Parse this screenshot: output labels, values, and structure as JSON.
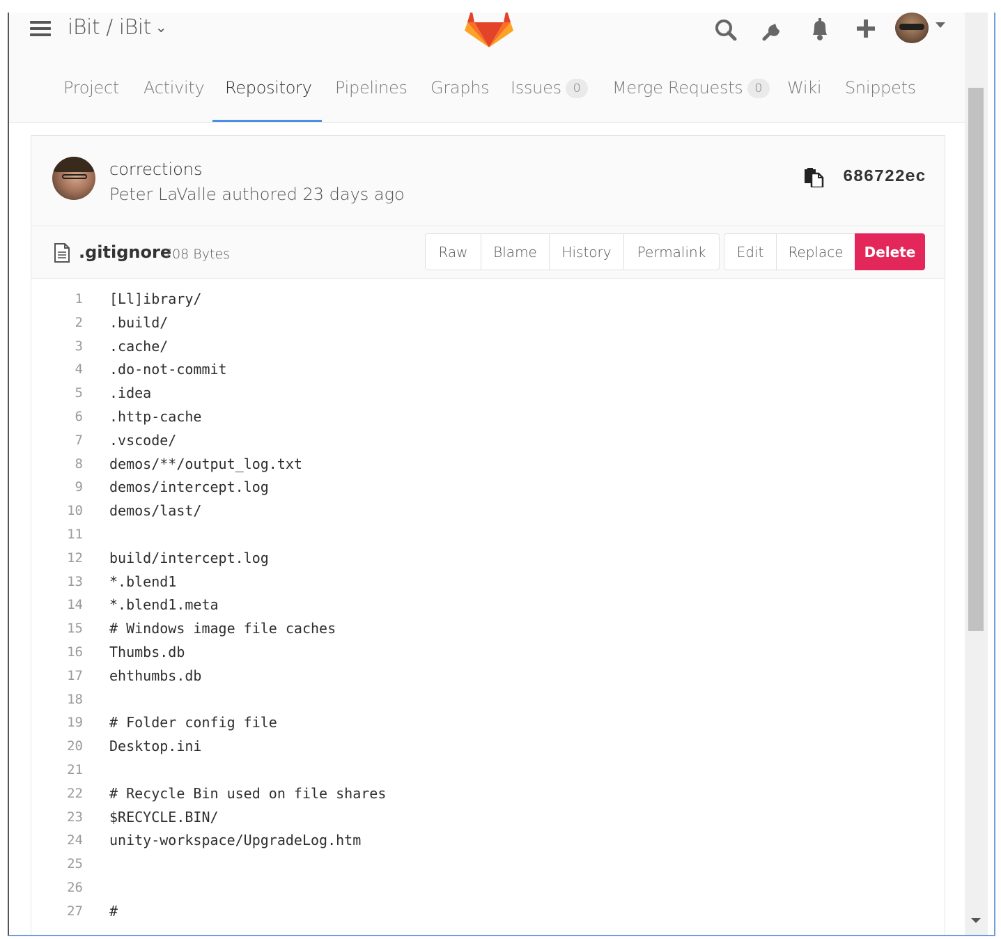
{
  "header": {
    "project_path": "iBit / iBit",
    "icons": [
      "search-icon",
      "wrench-icon",
      "bell-icon",
      "plus-icon",
      "user-avatar"
    ]
  },
  "nav": {
    "tabs": [
      {
        "label": "Project"
      },
      {
        "label": "Activity"
      },
      {
        "label": "Repository"
      },
      {
        "label": "Pipelines"
      },
      {
        "label": "Graphs"
      },
      {
        "label": "Issues",
        "count": "0"
      },
      {
        "label": "Merge Requests",
        "count": "0"
      },
      {
        "label": "Wiki"
      },
      {
        "label": "Snippets"
      }
    ],
    "active": "Repository"
  },
  "commit": {
    "message": "corrections",
    "meta": "Peter LaValle authored 23 days ago",
    "sha": "686722ec"
  },
  "file": {
    "name": ".gitignore",
    "size": "708 Bytes",
    "actions_group1": [
      "Raw",
      "Blame",
      "History",
      "Permalink"
    ],
    "actions_group2": [
      "Edit",
      "Replace",
      "Delete"
    ],
    "delete_color": "#e4275b"
  },
  "code_lines": [
    {
      "n": "1",
      "t": "[Ll]ibrary/"
    },
    {
      "n": "2",
      "t": ".build/"
    },
    {
      "n": "3",
      "t": ".cache/"
    },
    {
      "n": "4",
      "t": ".do-not-commit"
    },
    {
      "n": "5",
      "t": ".idea"
    },
    {
      "n": "6",
      "t": ".http-cache"
    },
    {
      "n": "7",
      "t": ".vscode/"
    },
    {
      "n": "8",
      "t": "demos/**/output_log.txt"
    },
    {
      "n": "9",
      "t": "demos/intercept.log"
    },
    {
      "n": "10",
      "t": "demos/last/"
    },
    {
      "n": "11",
      "t": ""
    },
    {
      "n": "12",
      "t": "build/intercept.log"
    },
    {
      "n": "13",
      "t": "*.blend1"
    },
    {
      "n": "14",
      "t": "*.blend1.meta"
    },
    {
      "n": "15",
      "t": "# Windows image file caches"
    },
    {
      "n": "16",
      "t": "Thumbs.db"
    },
    {
      "n": "17",
      "t": "ehthumbs.db"
    },
    {
      "n": "18",
      "t": ""
    },
    {
      "n": "19",
      "t": "# Folder config file"
    },
    {
      "n": "20",
      "t": "Desktop.ini"
    },
    {
      "n": "21",
      "t": ""
    },
    {
      "n": "22",
      "t": "# Recycle Bin used on file shares"
    },
    {
      "n": "23",
      "t": "$RECYCLE.BIN/"
    },
    {
      "n": "24",
      "t": "unity-workspace/UpgradeLog.htm"
    },
    {
      "n": "25",
      "t": ""
    },
    {
      "n": "26",
      "t": ""
    },
    {
      "n": "27",
      "t": "#"
    }
  ]
}
